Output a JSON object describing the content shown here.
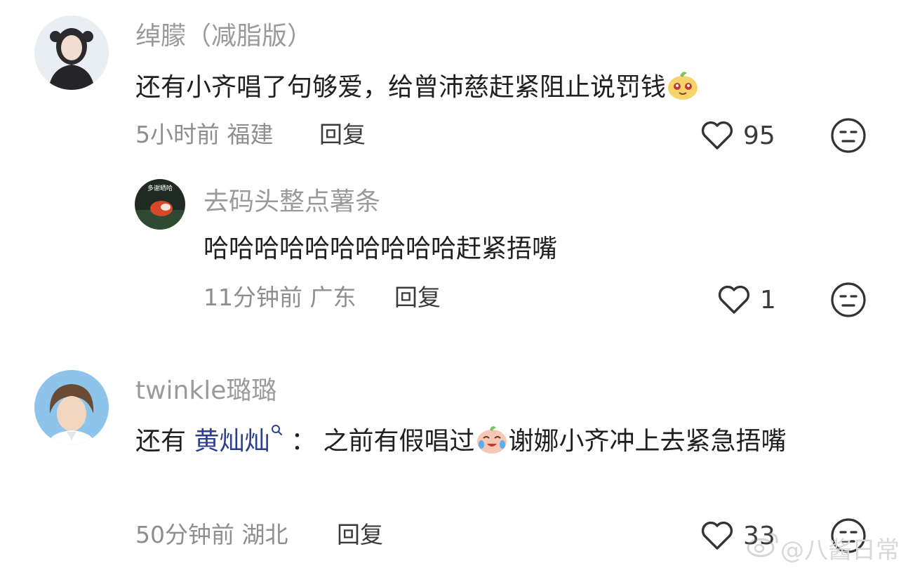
{
  "comments": [
    {
      "username": "绰朦（减脂版）",
      "text": "还有小齐唱了句够爱，给曾沛慈赶紧阻止说罚钱",
      "time": "5小时前",
      "location": "福建",
      "reply_label": "回复",
      "likes": "95"
    },
    {
      "username": "去码头整点薯条",
      "avatar_caption": "多谢晒哈",
      "text": "哈哈哈哈哈哈哈哈哈哈赶紧捂嘴",
      "time": "11分钟前",
      "location": "广东",
      "reply_label": "回复",
      "likes": "1"
    },
    {
      "username": "twinkle璐璐",
      "text_prefix": "还有 ",
      "mention": "黄灿灿",
      "text_colon": "：",
      "text_mid": "之前有假唱过",
      "text_suffix": "谢娜小齐冲上去紧急捂嘴",
      "time": "50分钟前",
      "location": "湖北",
      "reply_label": "回复",
      "likes": "33"
    }
  ],
  "watermark": "@八酱日常"
}
